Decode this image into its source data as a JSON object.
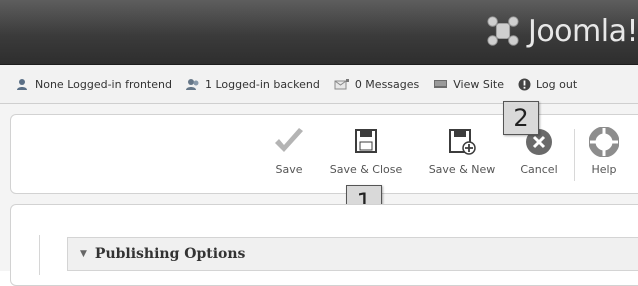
{
  "header": {
    "brand_name": "Joomla!",
    "colors": {
      "bar_top": "#5e5e5e",
      "bar_bottom": "#2e2e2e",
      "logo_text": "#e8e8e8"
    }
  },
  "statusbar": {
    "items": [
      {
        "icon": "user-icon",
        "label": "None Logged-in frontend"
      },
      {
        "icon": "users-icon",
        "label": "1 Logged-in backend"
      },
      {
        "icon": "message-icon",
        "label": "0 Messages"
      },
      {
        "icon": "monitor-icon",
        "label": "View Site"
      },
      {
        "icon": "info-icon",
        "label": "Log out"
      }
    ]
  },
  "toolbar": {
    "buttons": [
      {
        "icon": "checkmark-icon",
        "label": "Save"
      },
      {
        "icon": "floppy-icon",
        "label": "Save & Close"
      },
      {
        "icon": "floppy-plus-icon",
        "label": "Save & New"
      },
      {
        "icon": "cancel-icon",
        "label": "Cancel"
      },
      {
        "icon": "lifebuoy-icon",
        "label": "Help"
      }
    ]
  },
  "callouts": [
    "1",
    "2"
  ],
  "content": {
    "publishing_options_label": "Publishing Options"
  }
}
